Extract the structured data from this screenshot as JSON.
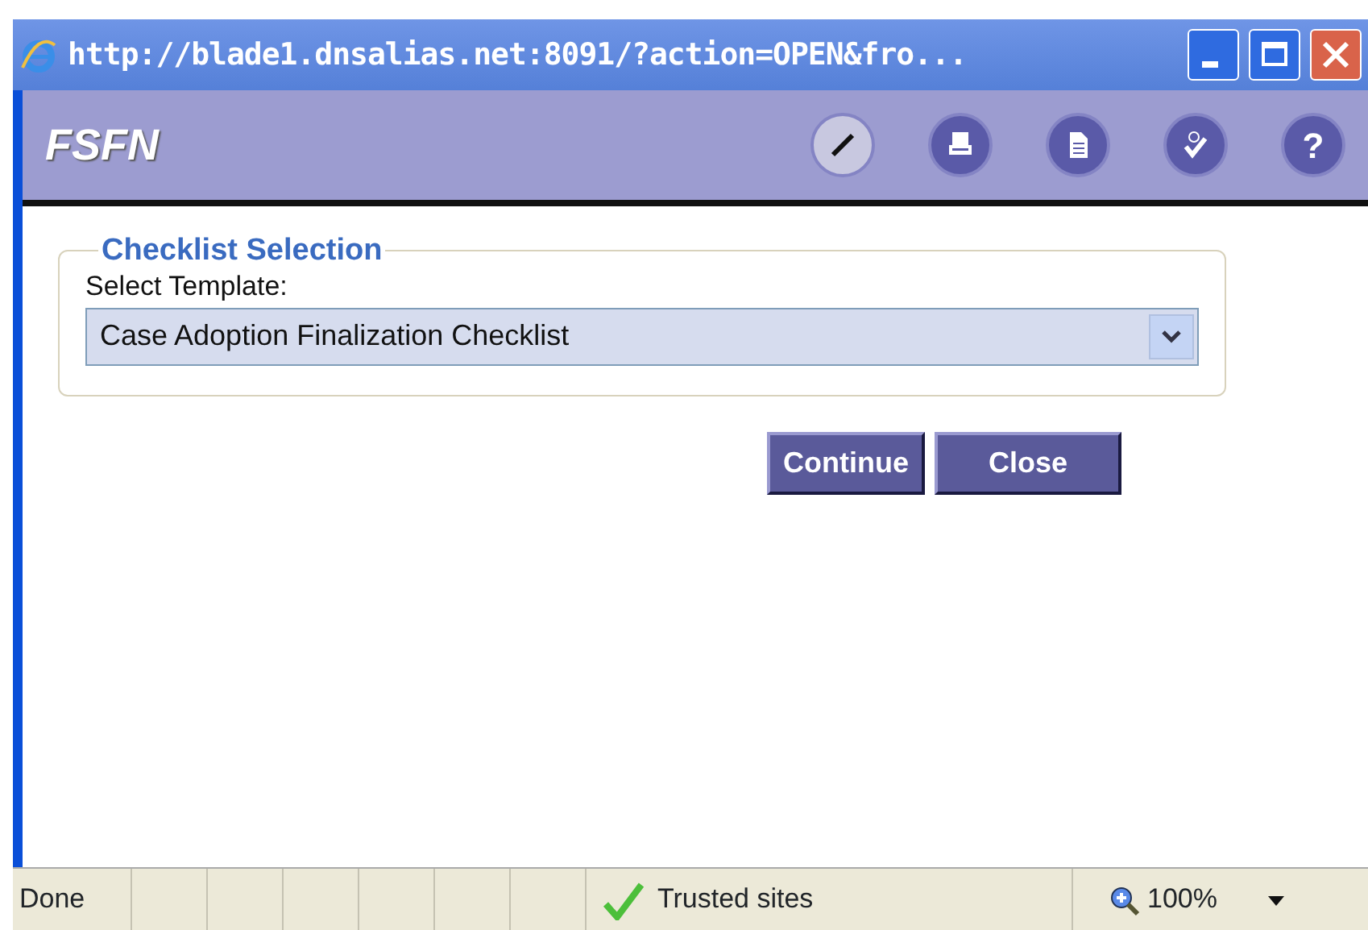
{
  "window": {
    "title": "http://blade1.dnsalias.net:8091/?action=OPEN&fro..."
  },
  "header": {
    "title": "FSFN",
    "tools": [
      {
        "kind": "pen"
      },
      {
        "kind": "print"
      },
      {
        "kind": "document"
      },
      {
        "kind": "spell"
      },
      {
        "kind": "help",
        "label": "?"
      }
    ]
  },
  "fieldset": {
    "legend": "Checklist Selection",
    "label": "Select Template:",
    "value": "Case Adoption Finalization Checklist"
  },
  "buttons": [
    "Continue",
    "Close"
  ],
  "status_bar": {
    "text": "Done",
    "zone": "Trusted sites",
    "zoom": "100%"
  }
}
